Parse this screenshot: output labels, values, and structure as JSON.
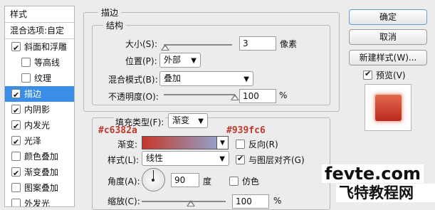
{
  "sidebar": {
    "header": "样式",
    "blend_options": "混合选项:自定",
    "items": [
      {
        "label": "斜面和浮雕",
        "checked": true,
        "indent": false,
        "selected": false
      },
      {
        "label": "等高线",
        "checked": false,
        "indent": true,
        "selected": false
      },
      {
        "label": "纹理",
        "checked": false,
        "indent": true,
        "selected": false
      },
      {
        "label": "描边",
        "checked": true,
        "indent": false,
        "selected": true
      },
      {
        "label": "内阴影",
        "checked": true,
        "indent": false,
        "selected": false
      },
      {
        "label": "内发光",
        "checked": true,
        "indent": false,
        "selected": false
      },
      {
        "label": "光泽",
        "checked": true,
        "indent": false,
        "selected": false
      },
      {
        "label": "颜色叠加",
        "checked": false,
        "indent": false,
        "selected": false
      },
      {
        "label": "渐变叠加",
        "checked": true,
        "indent": false,
        "selected": false
      },
      {
        "label": "图案叠加",
        "checked": false,
        "indent": false,
        "selected": false
      },
      {
        "label": "外发光",
        "checked": false,
        "indent": false,
        "selected": false
      }
    ]
  },
  "stroke": {
    "title": "描边",
    "structure_title": "结构",
    "size_label": "大小(S):",
    "size_value": "3",
    "size_unit": "像素",
    "position_label": "位置(P):",
    "position_value": "外部",
    "blend_mode_label": "混合模式(B):",
    "blend_mode_value": "叠加",
    "opacity_label": "不透明度(O):",
    "opacity_value": "100",
    "opacity_unit": "%"
  },
  "fill": {
    "fill_type_label": "填充类型(F):",
    "fill_type_value": "渐变",
    "gradient_label": "渐变:",
    "gradient_start_color": "#c6382a",
    "gradient_end_color": "#939fc6",
    "gradient_start_label": "#c6382a",
    "gradient_end_label": "#939fc6",
    "reverse_label": "反向(R)",
    "reverse_checked": false,
    "style_label": "样式(L):",
    "style_value": "线性",
    "align_label": "与图层对齐(G)",
    "align_checked": true,
    "angle_label": "角度(A):",
    "angle_value": "90",
    "angle_unit": "度",
    "dither_label": "仿色",
    "dither_checked": false,
    "scale_label": "缩放(C):",
    "scale_value": "100",
    "scale_unit": "%"
  },
  "buttons": {
    "ok": "确定",
    "cancel": "取消",
    "new_style": "新建样式(W)...",
    "preview_label": "预览(V)",
    "preview_checked": true
  },
  "watermark": {
    "line1": "fevte.com",
    "line2": "飞特教程网"
  }
}
